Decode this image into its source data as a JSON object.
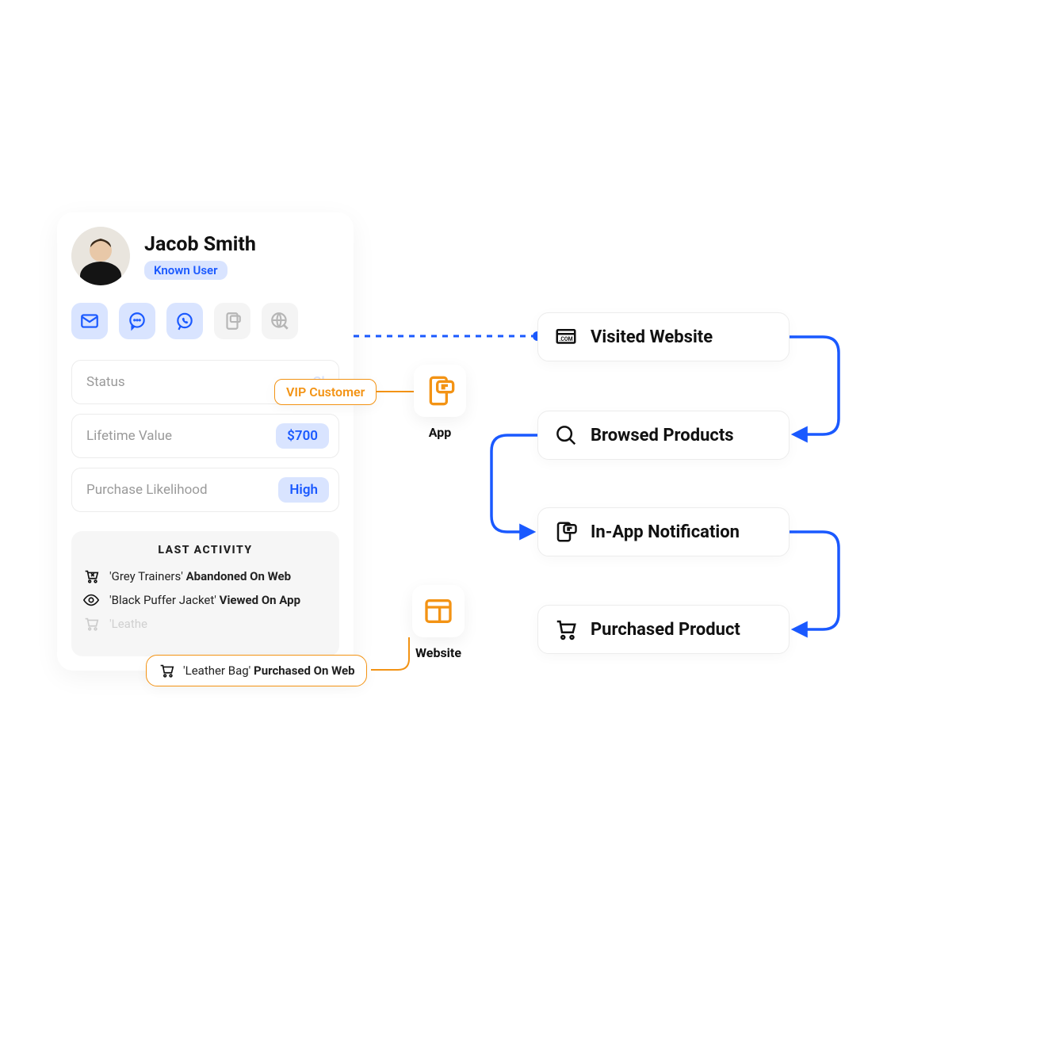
{
  "profile": {
    "name": "Jacob Smith",
    "user_type": "Known User",
    "channels": [
      "email",
      "chat",
      "whatsapp",
      "inapp",
      "web"
    ],
    "stats": {
      "status_label": "Status",
      "status_hint": "Ch",
      "lifetime_label": "Lifetime Value",
      "lifetime_value": "$700",
      "purchase_label": "Purchase Likelihood",
      "purchase_value": "High"
    },
    "activity": {
      "title": "LAST ACTIVITY",
      "rows": [
        {
          "icon": "cart-x",
          "product": "'Grey Trainers'",
          "action": "Abandoned On Web"
        },
        {
          "icon": "eye",
          "product": "'Black Puffer Jacket'",
          "action": "Viewed On App"
        },
        {
          "icon": "cart",
          "product": "'Leathe",
          "action": "",
          "dim": true
        }
      ]
    }
  },
  "callouts": {
    "vip": "VIP Customer",
    "purchase_row": {
      "product": "'Leather Bag'",
      "action": "Purchased On Web"
    }
  },
  "sources": {
    "app": "App",
    "web": "Website"
  },
  "journey": [
    {
      "icon": "website",
      "label": "Visited Website"
    },
    {
      "icon": "search",
      "label": "Browsed Products"
    },
    {
      "icon": "inapp",
      "label": "In-App Notification"
    },
    {
      "icon": "cart",
      "label": "Purchased Product"
    }
  ],
  "colors": {
    "accent": "#1a59ff",
    "highlight": "#f39314"
  }
}
